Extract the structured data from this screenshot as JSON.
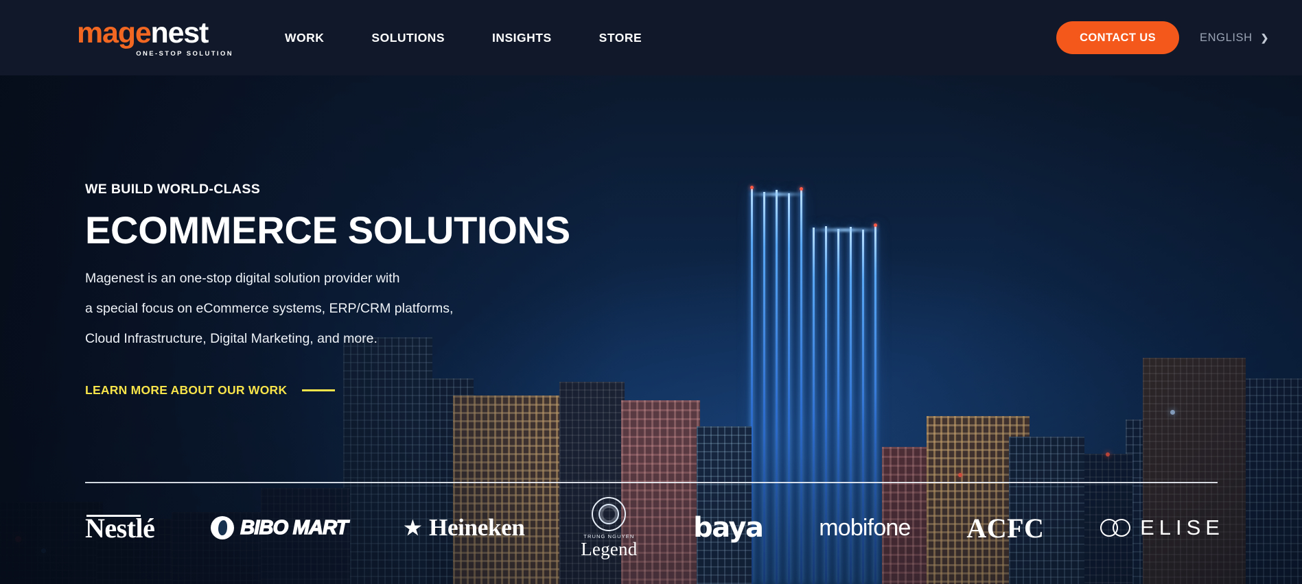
{
  "header": {
    "logo": {
      "orange_part": "mage",
      "white_part": "nest",
      "tagline": "ONE-STOP SOLUTION"
    },
    "nav": [
      {
        "label": "WORK"
      },
      {
        "label": "SOLUTIONS"
      },
      {
        "label": "INSIGHTS"
      },
      {
        "label": "STORE"
      }
    ],
    "contact_label": "CONTACT US",
    "language_label": "ENGLISH",
    "language_chevron": "chevron-right-icon",
    "bar_color": "#101829",
    "accent_color": "#f4581a"
  },
  "hero": {
    "eyebrow": "WE BUILD WORLD-CLASS",
    "headline": "ECOMMERCE SOLUTIONS",
    "paragraph_lines": [
      "Magenest is an one-stop digital solution provider with",
      "a special focus on eCommerce systems, ERP/CRM platforms,",
      "Cloud Infrastructure, Digital Marketing, and more."
    ],
    "cta_label": "LEARN MORE ABOUT OUR WORK",
    "cta_color": "#f7e34a"
  },
  "brands": {
    "items": [
      {
        "name": "Nestle",
        "display": "Nestlé"
      },
      {
        "name": "BIBO MART",
        "display": "BIBO MART"
      },
      {
        "name": "Heineken",
        "display": "Heineken",
        "star": "★"
      },
      {
        "name": "Trung Nguyen Legend",
        "display": "Legend",
        "sub": "TRUNG NGUYEN"
      },
      {
        "name": "baya",
        "display": "baya"
      },
      {
        "name": "mobifone",
        "display": "mobifone"
      },
      {
        "name": "ACFC",
        "display": "ACFC"
      },
      {
        "name": "ELISE",
        "display": "ELISE"
      }
    ]
  },
  "background": {
    "description": "night city skyline with blue-lit skyscraper",
    "sky_top": "#0b1526",
    "sky_bottom": "#123760"
  }
}
